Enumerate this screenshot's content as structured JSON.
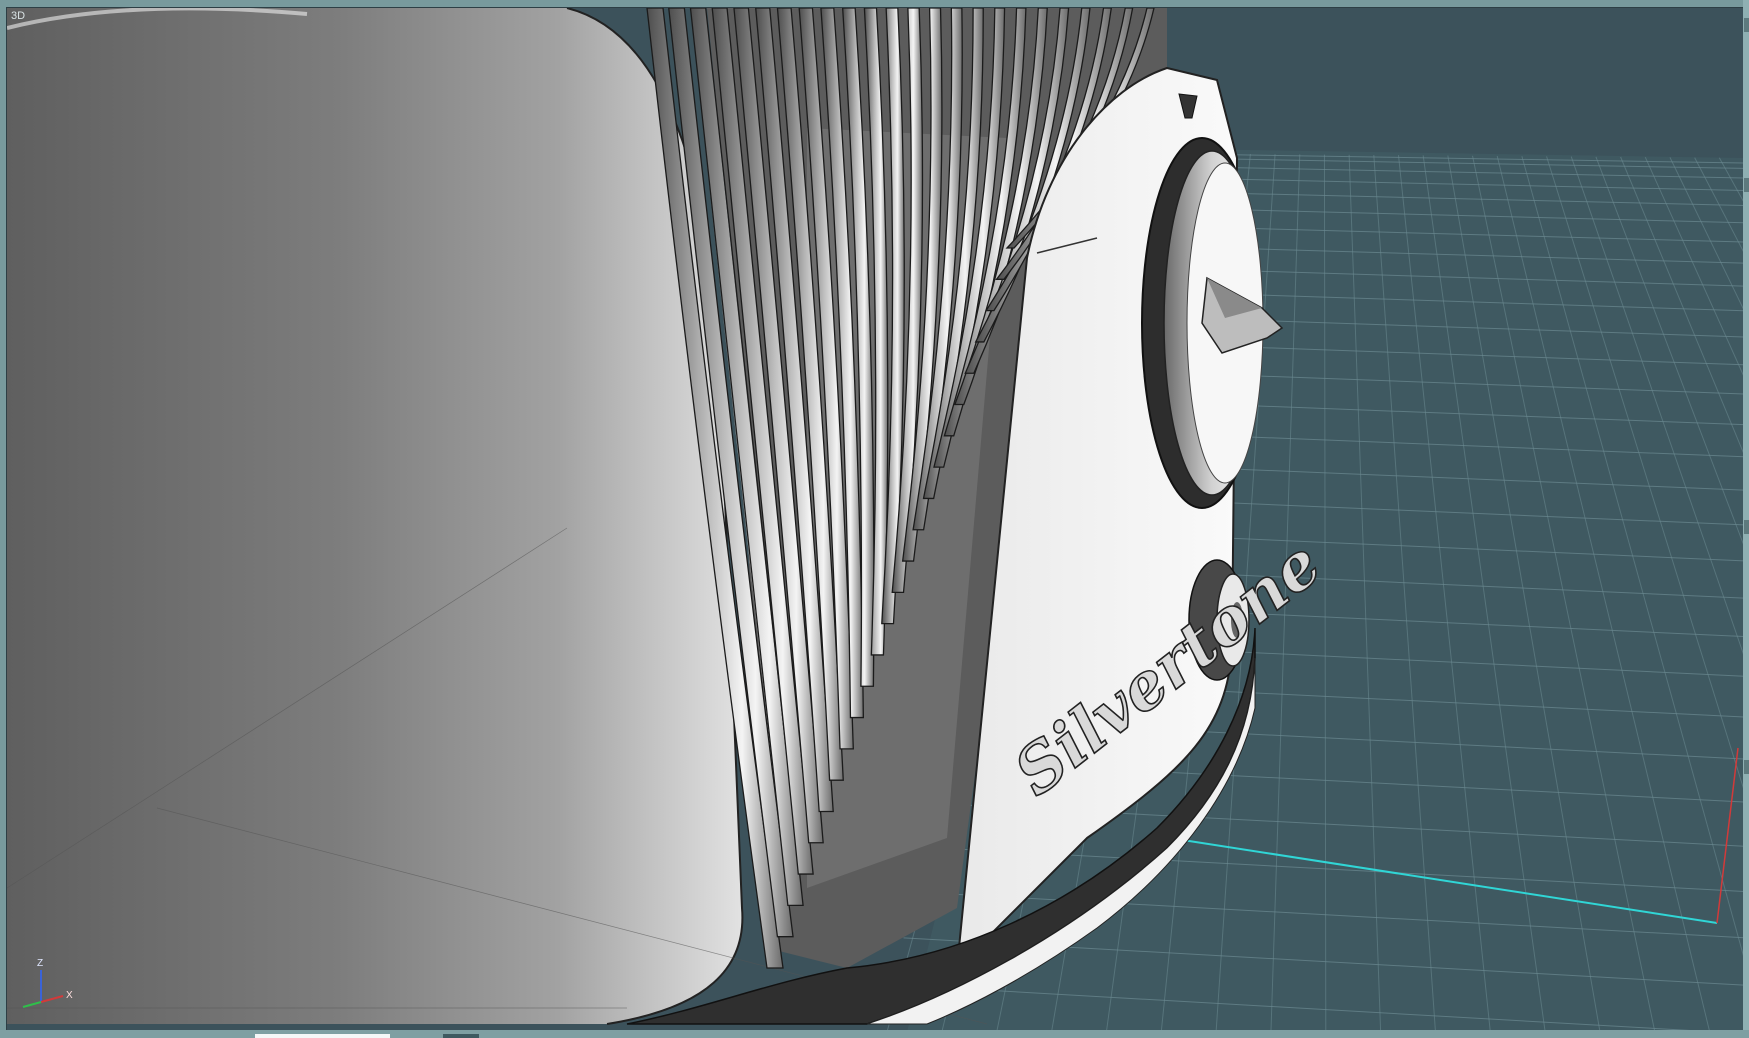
{
  "viewport": {
    "label": "3D",
    "background": "#3c525b",
    "grid_color": "#6c8a92",
    "x_axis_color": "#30d6d6",
    "y_axis_color": "#d23a3a"
  },
  "model": {
    "badge_text": "Silvertone"
  },
  "axis_triad": {
    "z": "Z",
    "x": "X"
  }
}
